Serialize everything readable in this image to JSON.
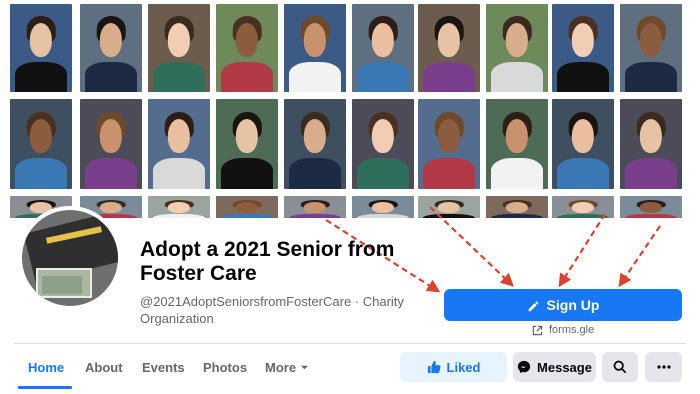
{
  "page": {
    "title": "Adopt a 2021 Senior from Foster Care",
    "handle_category": "@2021AdoptSeniorsfromFosterCare · Charity Organization"
  },
  "cta": {
    "label": "Sign Up",
    "icon": "pencil-icon",
    "link_text": "forms.gle",
    "link_icon": "external-link-icon",
    "color": "#1877f2"
  },
  "nav": {
    "tabs": [
      {
        "label": "Home",
        "active": true
      },
      {
        "label": "About"
      },
      {
        "label": "Events"
      },
      {
        "label": "Photos"
      },
      {
        "label": "More"
      }
    ]
  },
  "actions": {
    "liked_label": "Liked",
    "message_label": "Message",
    "search_icon": "search-icon",
    "more_icon": "ellipsis-icon"
  },
  "cover": {
    "description_icons": [
      "senior-portrait-photos",
      "red-dashed-arrows"
    ]
  },
  "colors": {
    "accent": "#1877f2",
    "arrow": "#d9432f",
    "text_secondary": "#65676b"
  }
}
